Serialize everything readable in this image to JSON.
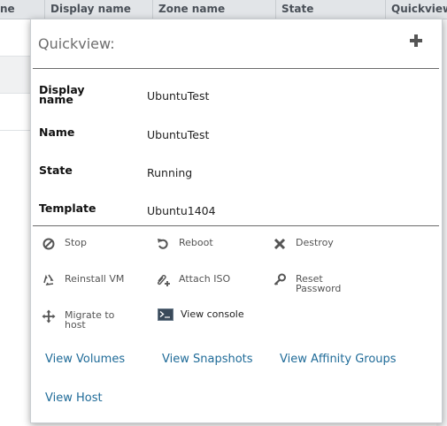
{
  "table": {
    "columns": [
      "ne",
      "Display name",
      "Zone name",
      "State",
      "Quickview"
    ]
  },
  "quickview": {
    "title": "Quickview:",
    "details": [
      {
        "label": "Display name",
        "value": "UbuntuTest"
      },
      {
        "label": "Name",
        "value": "UbuntuTest"
      },
      {
        "label": "State",
        "value": "Running"
      },
      {
        "label": "Template",
        "value": "Ubuntu1404"
      }
    ],
    "actions": [
      {
        "label": "Stop",
        "icon": "stop-icon"
      },
      {
        "label": "Reboot",
        "icon": "reboot-icon"
      },
      {
        "label": "Destroy",
        "icon": "destroy-icon"
      },
      {
        "label": "Reinstall VM",
        "icon": "recycle-icon"
      },
      {
        "label": "Attach ISO",
        "icon": "paperclip-plus-icon"
      },
      {
        "label": "Reset Password",
        "icon": "key-icon"
      },
      {
        "label": "Migrate to host",
        "icon": "move-arrows-icon"
      },
      {
        "label": "View console",
        "icon": "console-icon"
      }
    ],
    "links": [
      "View Volumes",
      "View Snapshots",
      "View Affinity Groups",
      "View Host"
    ]
  },
  "colors": {
    "link": "#1f6b98",
    "header_bg": "#e2e5e8",
    "divider": "#6b6b6b"
  }
}
